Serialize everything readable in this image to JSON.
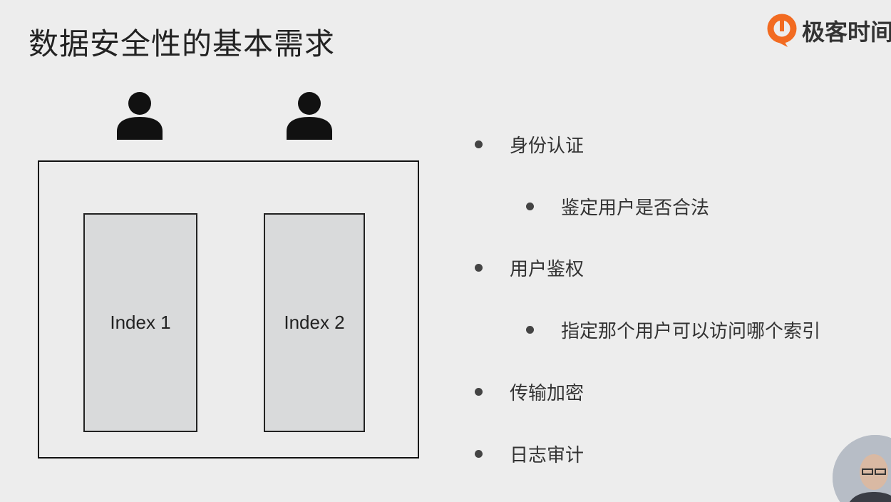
{
  "slide": {
    "title": "数据安全性的基本需求",
    "logo_text": "极客时间"
  },
  "diagram": {
    "index_boxes": [
      {
        "label": "Index 1"
      },
      {
        "label": "Index 2"
      }
    ]
  },
  "bullets": [
    {
      "text": "身份认证",
      "level": 1
    },
    {
      "text": "鉴定用户是否合法",
      "level": 2
    },
    {
      "text": "用户鉴权",
      "level": 1
    },
    {
      "text": "指定那个用户可以访问哪个索引",
      "level": 2
    },
    {
      "text": "传输加密",
      "level": 1
    },
    {
      "text": "日志审计",
      "level": 1
    }
  ],
  "colors": {
    "background": "#ededed",
    "logo_orange": "#f26b21",
    "index_fill": "#d9dadb"
  }
}
